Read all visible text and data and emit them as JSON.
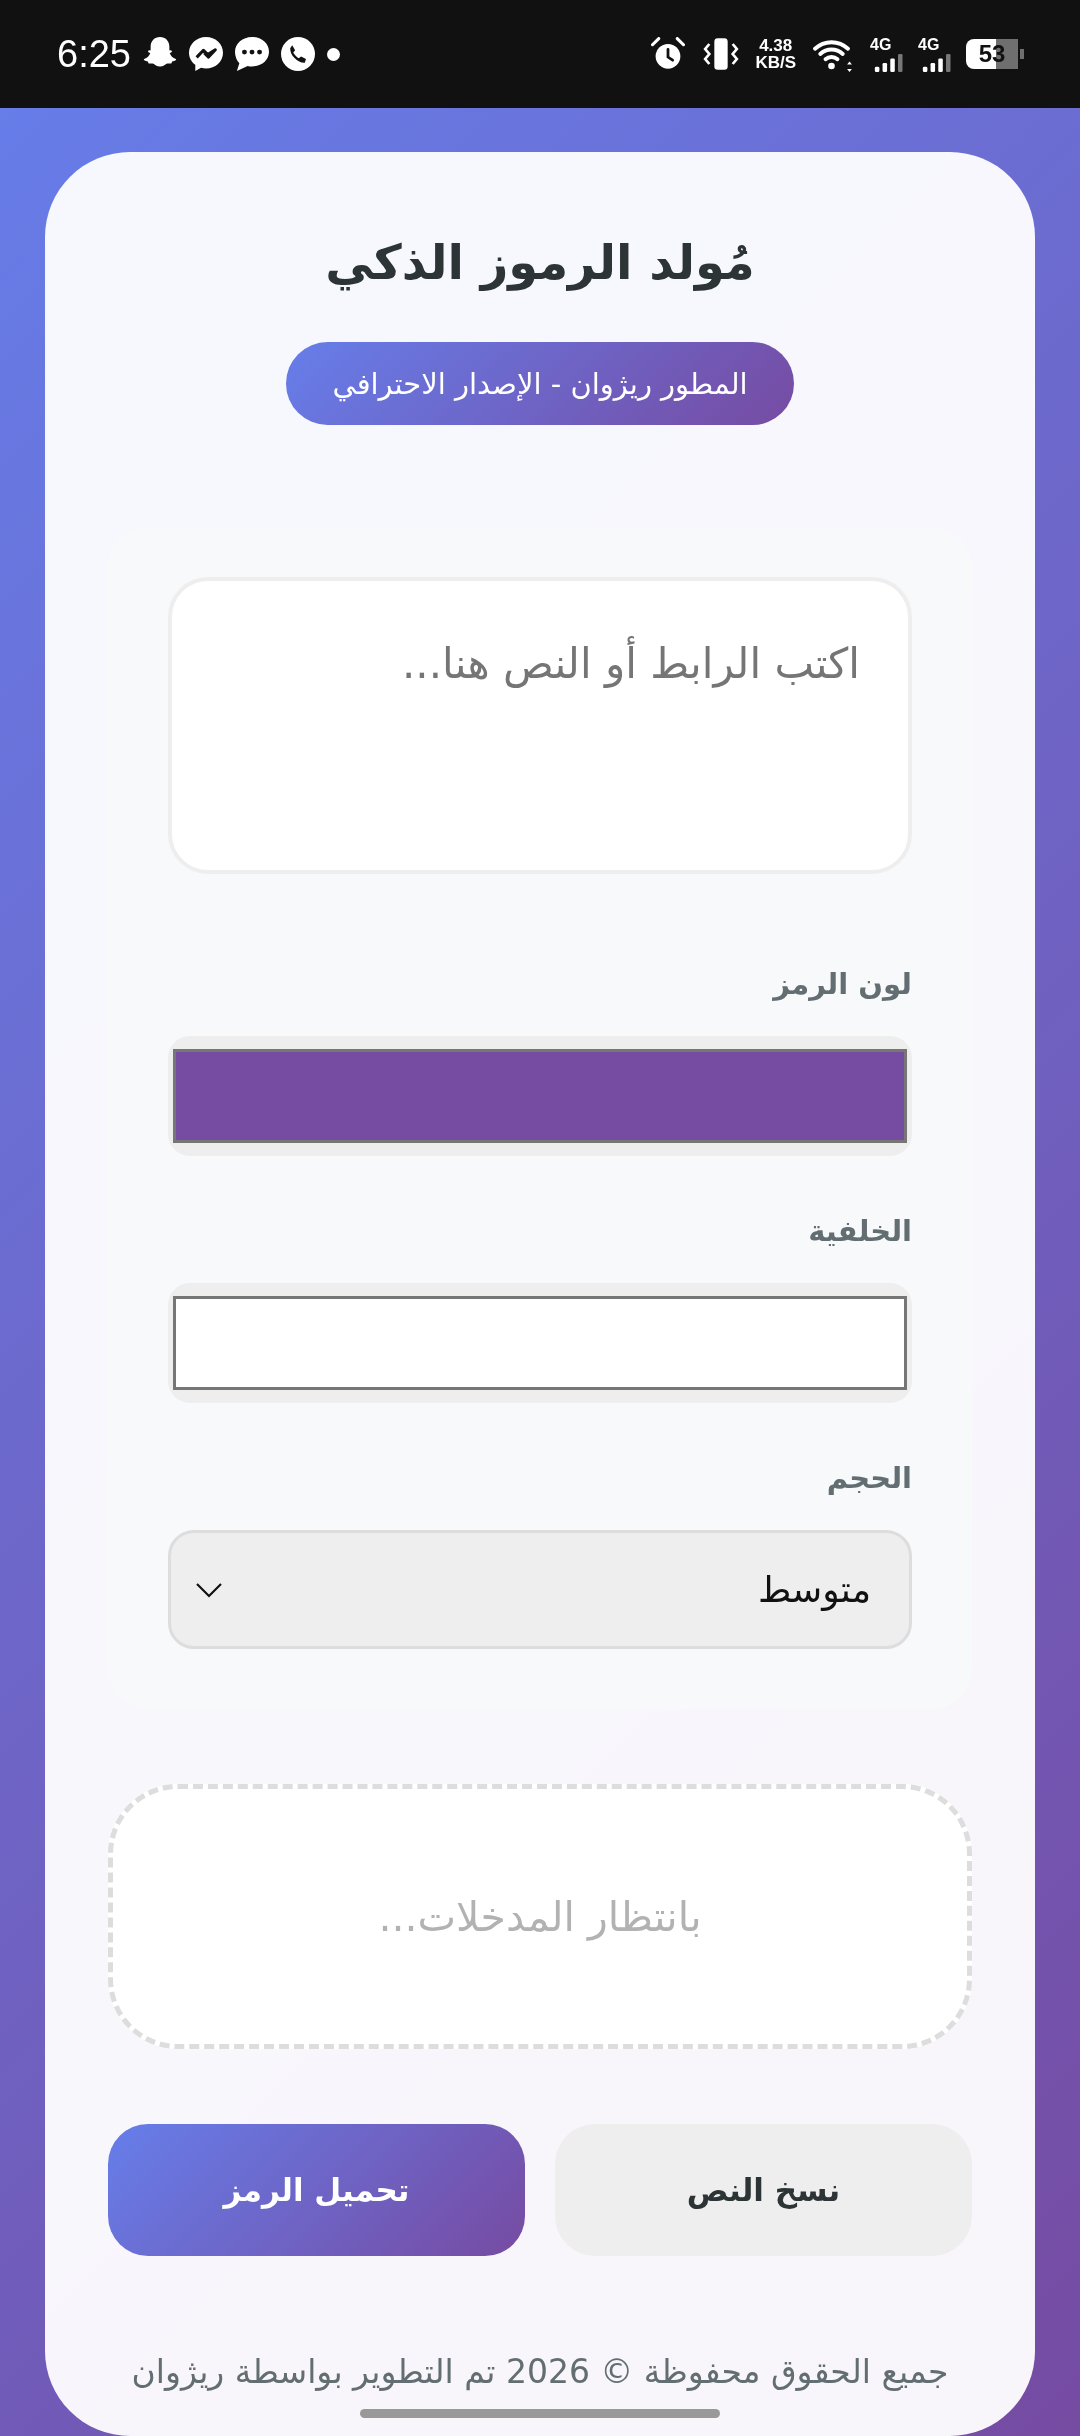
{
  "status_bar": {
    "time": "6:25",
    "network_speed": {
      "value": "4.38",
      "unit": "KB/S"
    },
    "networks": [
      {
        "label": "4G"
      },
      {
        "label": "4G"
      }
    ],
    "battery": {
      "label": "53"
    }
  },
  "header": {
    "title": "مُولد الرموز الذكي",
    "badge": "المطور ريژوان - الإصدار الاحترافي"
  },
  "form": {
    "text_input": {
      "placeholder": "اكتب الرابط أو النص هنا..."
    },
    "fields": [
      {
        "kind": "color",
        "label": "لون الرمز",
        "color": "#764ba2"
      },
      {
        "kind": "color",
        "label": "الخلفية",
        "color": "#ffffff"
      },
      {
        "kind": "select",
        "label": "الحجم",
        "value": "متوسط"
      }
    ]
  },
  "result": {
    "message": "بانتظار المدخلات..."
  },
  "buttons": [
    {
      "kind": "copy",
      "label": "نسخ النص"
    },
    {
      "kind": "download",
      "label": "تحميل الرمز"
    }
  ],
  "footer": {
    "text": "جميع الحقوق محفوظة © 2026 تم التطوير بواسطة ريژوان"
  }
}
